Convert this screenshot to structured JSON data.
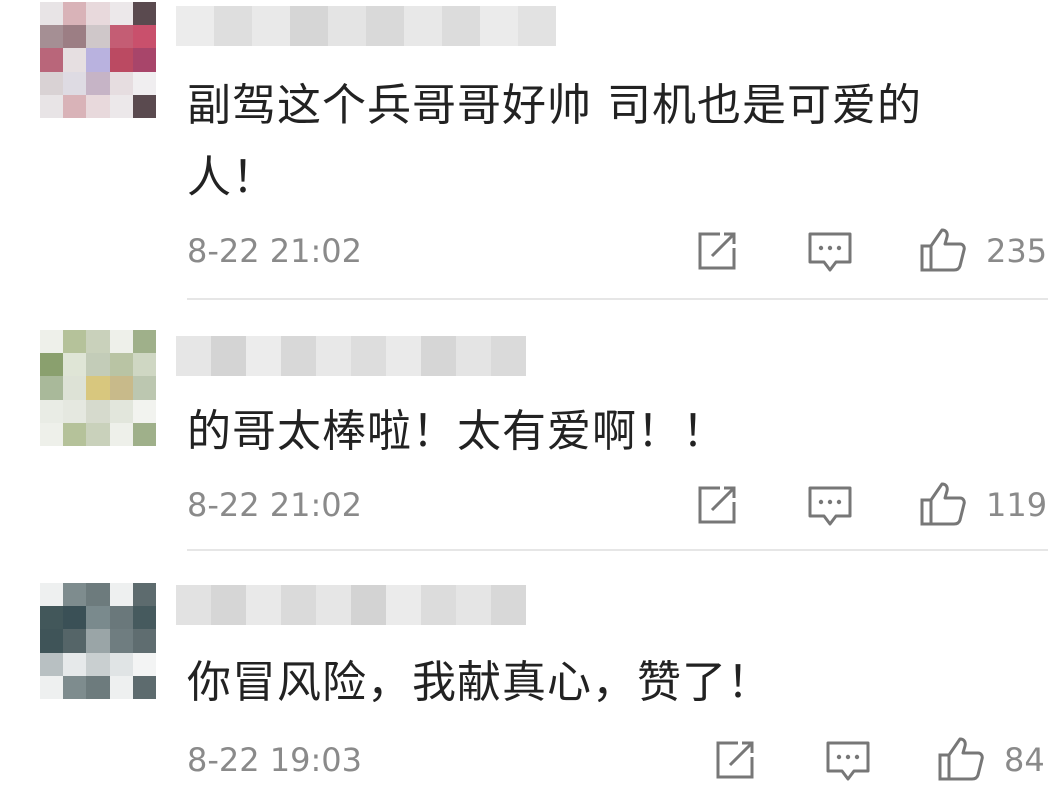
{
  "comments": [
    {
      "text": "副驾这个兵哥哥好帅 司机也是可爱的人！",
      "time": "8-22 21:02",
      "likes": "235",
      "avatar_colors": [
        "#e8e4e6",
        "#d9b3b8",
        "#e8d9dc",
        "#ece8ea",
        "#5a4a4f",
        "#a58f94",
        "#9c7e84",
        "#cfc7c9",
        "#c45d74",
        "#c9506c",
        "#b9667a",
        "#e6dfe1",
        "#b9b2df",
        "#bb4a62",
        "#a8456a",
        "#d9d2d4",
        "#dedbe3",
        "#c6b4c6",
        "#e6dde0",
        "#f0eef0"
      ]
    },
    {
      "text": "的哥太棒啦！太有爱啊！！",
      "time": "8-22 21:02",
      "likes": "119",
      "avatar_colors": [
        "#eef0ea",
        "#b5c29a",
        "#c9d1bb",
        "#eef0ea",
        "#9fb08a",
        "#8aa06e",
        "#dfe5d6",
        "#c3ccb8",
        "#b9c4a4",
        "#cfd7c3",
        "#a9b99a",
        "#dde2d6",
        "#d8c77e",
        "#c8ba8a",
        "#bcc7b0",
        "#e9ece5",
        "#e5e8e0",
        "#d6dacd",
        "#e2e6dc",
        "#f2f3ef"
      ]
    },
    {
      "text": "你冒风险，我献真心，赞了！",
      "time": "8-22 19:03",
      "likes": "84",
      "avatar_colors": [
        "#eef0f0",
        "#7e8c8e",
        "#6d7b7d",
        "#eef0f0",
        "#5d6b6e",
        "#42575a",
        "#3a5056",
        "#7a8a8d",
        "#6a787b",
        "#465a5e",
        "#3f5458",
        "#556568",
        "#9aa5a7",
        "#6f7d80",
        "#5f6d70",
        "#b8c0c2",
        "#e6e9ea",
        "#c9cfd0",
        "#e0e4e5",
        "#f3f4f4"
      ]
    }
  ],
  "icons": {
    "share": "share-icon",
    "reply": "reply-icon",
    "like": "thumbs-up-icon"
  }
}
